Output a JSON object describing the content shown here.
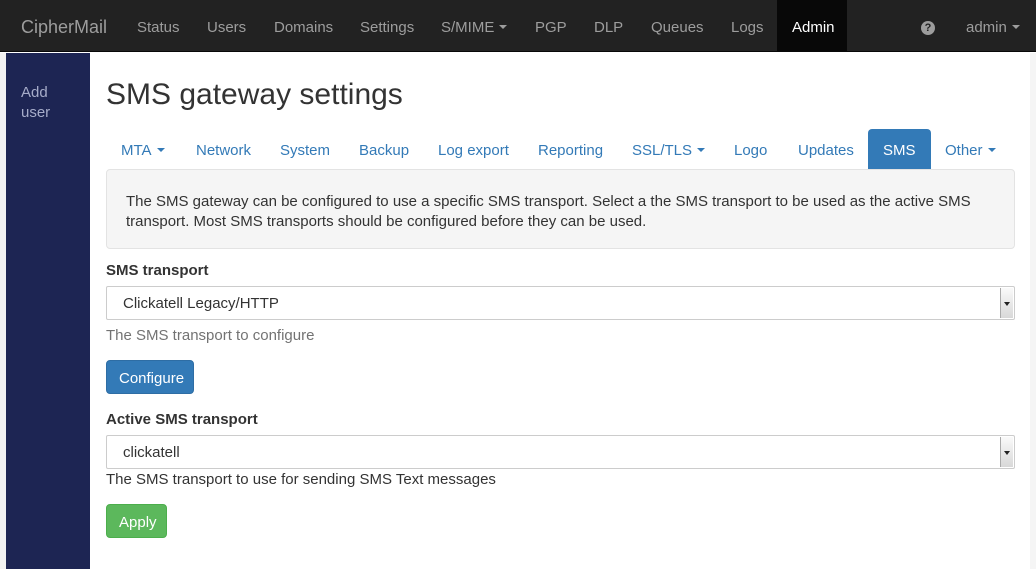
{
  "navbar": {
    "brand": "CipherMail",
    "items": [
      "Status",
      "Users",
      "Domains",
      "Settings",
      "S/MIME",
      "PGP",
      "DLP",
      "Queues",
      "Logs",
      "Admin"
    ],
    "active": "Admin",
    "help_icon": "question-circle-icon",
    "user_menu": "admin"
  },
  "sidebar": {
    "add_user": "Add user"
  },
  "page": {
    "title": "SMS gateway settings"
  },
  "tabs": {
    "items": [
      "MTA",
      "Network",
      "System",
      "Backup",
      "Log export",
      "Reporting",
      "SSL/TLS",
      "Logo",
      "Updates",
      "SMS",
      "Other"
    ],
    "active": "SMS"
  },
  "info": {
    "text": "The SMS gateway can be configured to use a specific SMS transport. Select a the SMS transport to be used as the active SMS transport. Most SMS transports should be configured before they can be used."
  },
  "sms_transport": {
    "label": "SMS transport",
    "value": "Clickatell Legacy/HTTP",
    "help": "The SMS transport to configure",
    "button": "Configure"
  },
  "active_transport": {
    "label": "Active SMS transport",
    "value": "clickatell",
    "help": "The SMS transport to use for sending SMS Text messages",
    "button": "Apply"
  },
  "colors": {
    "navbar": "#222222",
    "sidebar": "#1d2553",
    "link": "#337ab7",
    "success": "#5cb85c"
  }
}
